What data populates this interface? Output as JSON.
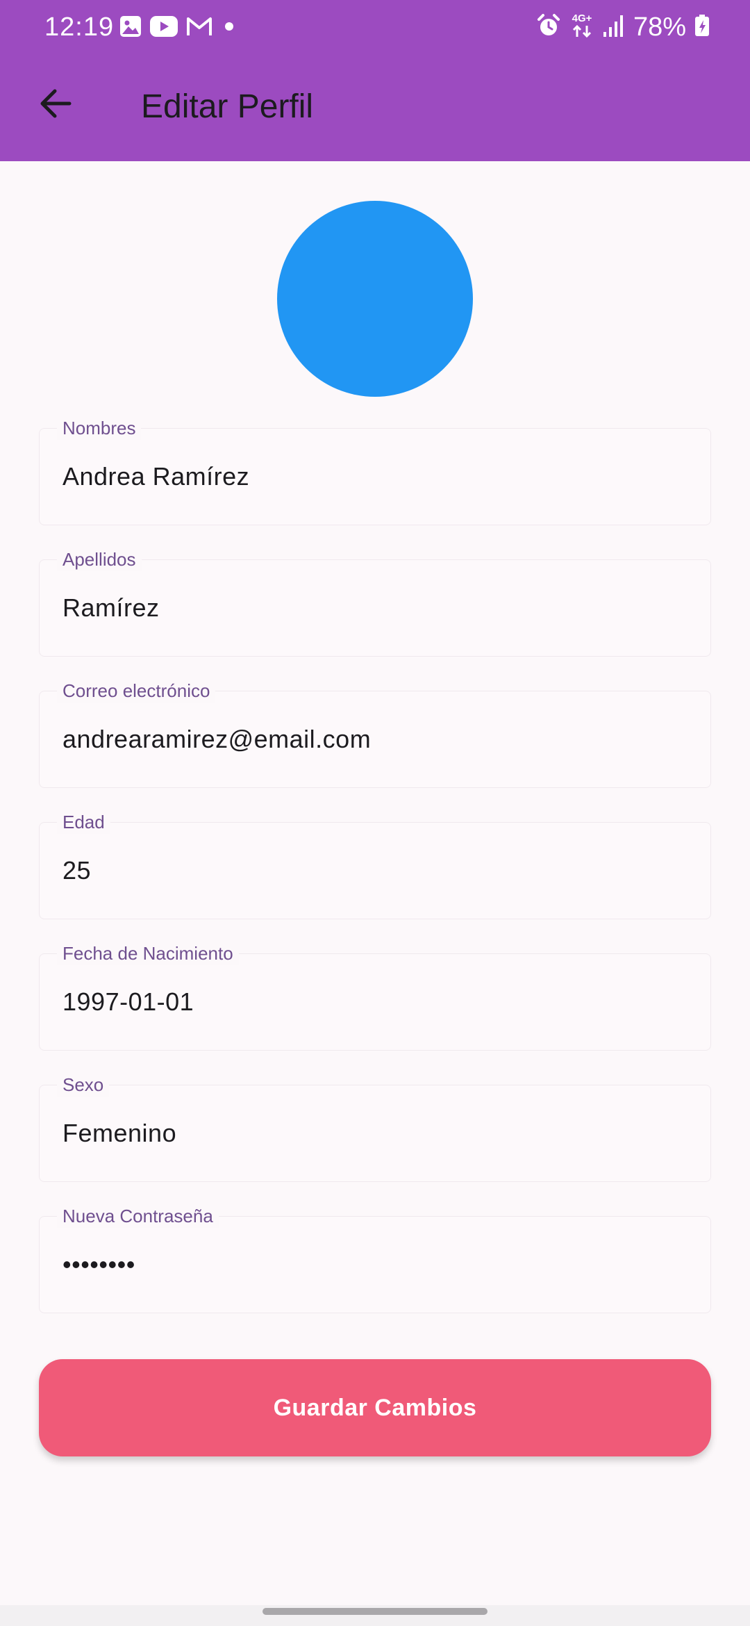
{
  "status_bar": {
    "time": "12:19",
    "left_icons": [
      "gallery-icon",
      "youtube-icon",
      "gmail-icon",
      "dot-icon"
    ],
    "right_icons": [
      "alarm-icon",
      "4g-data-icon",
      "signal-icon",
      "battery-charging-icon"
    ],
    "network_label": "4G+",
    "battery_percent": "78%"
  },
  "toolbar": {
    "back_icon": "arrow-back-icon",
    "title": "Editar Perfil"
  },
  "avatar": {
    "color": "#2196f3"
  },
  "form": {
    "fields": [
      {
        "label": "Nombres",
        "value": "Andrea Ramírez"
      },
      {
        "label": "Apellidos",
        "value": "Ramírez"
      },
      {
        "label": "Correo electrónico",
        "value": "andrearamirez@email.com"
      },
      {
        "label": "Edad",
        "value": "25"
      },
      {
        "label": "Fecha de Nacimiento",
        "value": "1997-01-01"
      },
      {
        "label": "Sexo",
        "value": "Femenino"
      },
      {
        "label": "Nueva Contraseña",
        "value": "••••••••"
      }
    ]
  },
  "save_button": {
    "label": "Guardar Cambios"
  },
  "colors": {
    "app_bar": "#9c4bc0",
    "background": "#fcf8fa",
    "label": "#6f4f8f",
    "button": "#f05a78"
  }
}
